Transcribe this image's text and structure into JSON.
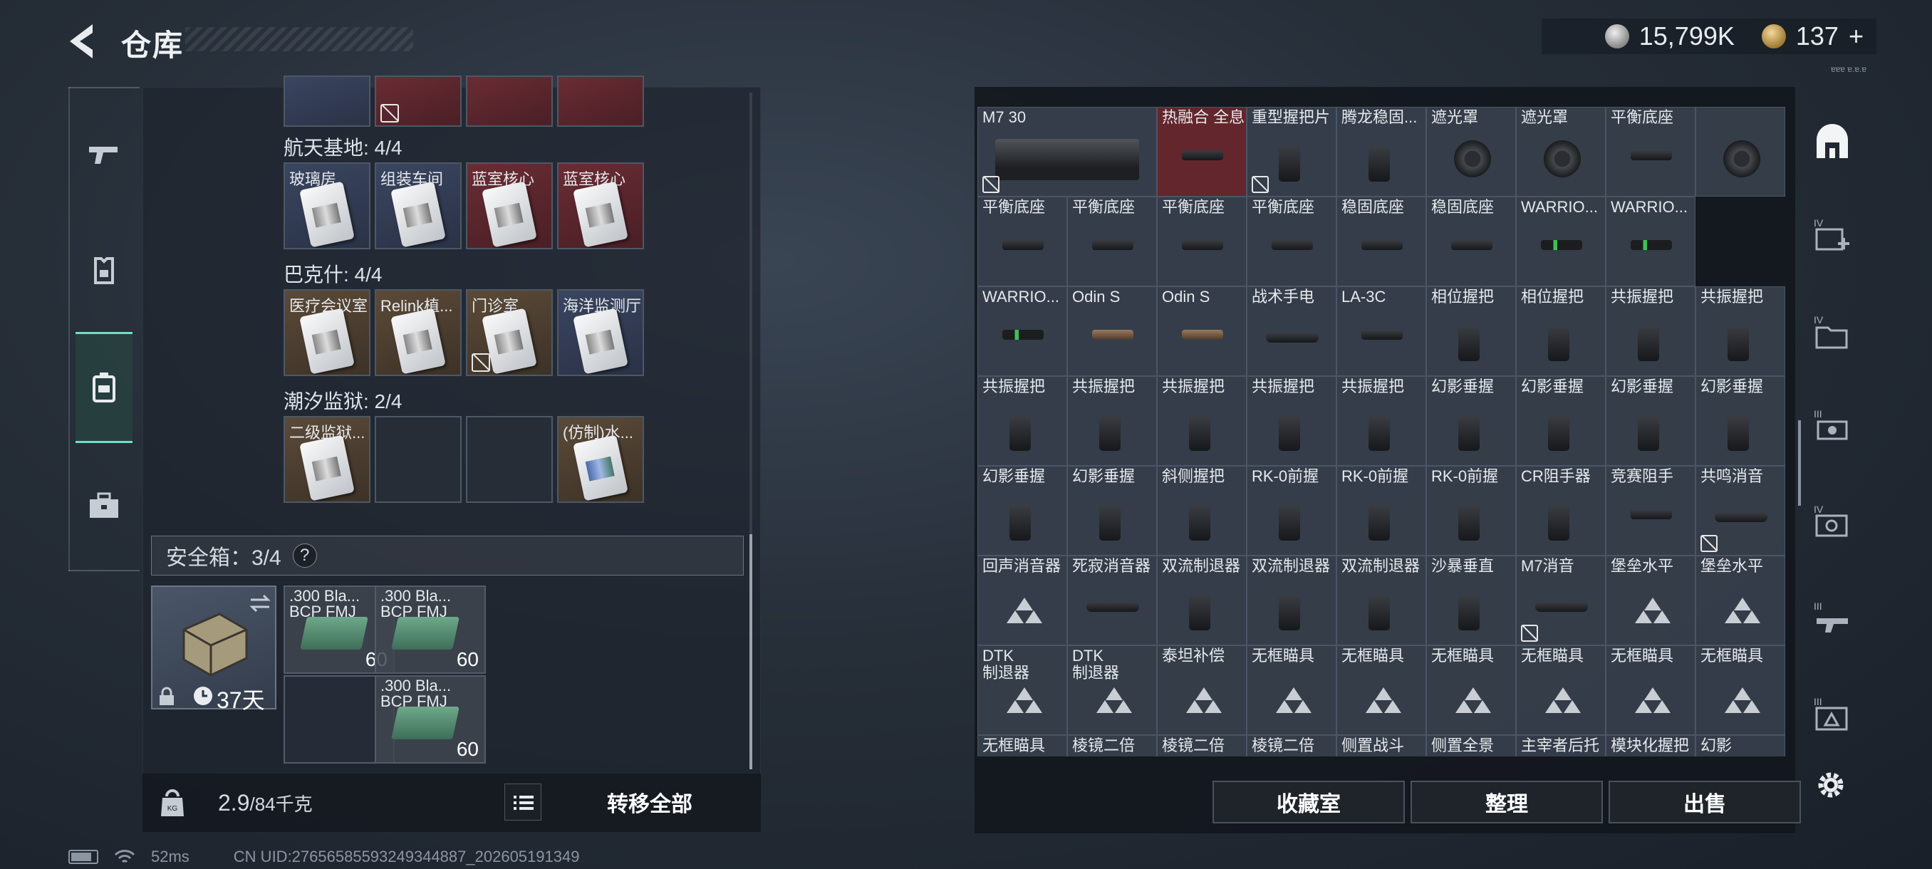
{
  "header": {
    "title": "仓库",
    "silver": "15,799K",
    "gold": "137",
    "gold_plus": "+",
    "version": "ɐɐɐ ɐ.ɐ.ɐ"
  },
  "left_nav": {
    "items": [
      {
        "icon": "gun-icon"
      },
      {
        "icon": "armor-icon"
      },
      {
        "icon": "backpack-icon"
      },
      {
        "icon": "briefcase-icon"
      }
    ]
  },
  "sections": [
    {
      "title": "航天基地: 4/4",
      "cards": [
        {
          "label": "玻璃房",
          "color": "blue"
        },
        {
          "label": "组装车间",
          "color": "blue"
        },
        {
          "label": "蓝室核心",
          "color": "red"
        },
        {
          "label": "蓝室核心",
          "color": "red"
        }
      ]
    },
    {
      "title": "巴克什: 4/4",
      "cards": [
        {
          "label": "医疗会议室",
          "color": "brown"
        },
        {
          "label": "Relink植...",
          "color": "brown"
        },
        {
          "label": "门诊室",
          "color": "brown"
        },
        {
          "label": "海洋监测厅",
          "color": "blue"
        }
      ]
    },
    {
      "title": "潮汐监狱: 2/4",
      "cards": [
        {
          "label": "二级监狱...",
          "color": "brown"
        },
        {
          "label": "",
          "color": "empty"
        },
        {
          "label": "",
          "color": "empty"
        },
        {
          "label": "(仿制)水...",
          "color": "brown"
        }
      ]
    }
  ],
  "safe": {
    "title": "安全箱：3/4",
    "help": "?",
    "days": "37天",
    "ammo": [
      {
        "name": ".300 Bla...",
        "type": "BCP FMJ",
        "qty": "60"
      },
      {
        "name": ".300 Bla...",
        "type": "BCP FMJ",
        "qty": "60"
      },
      {
        "name": ".300 Bla...",
        "type": "BCP FMJ",
        "qty": "60"
      }
    ]
  },
  "bottom": {
    "weight": "2.9",
    "weight_max": "/84千克",
    "transfer": "转移全部"
  },
  "grid": {
    "rows": [
      [
        "M7 30",
        "热融合 全息",
        "重型握把片",
        "腾龙稳固...",
        "遮光罩",
        "遮光罩",
        "平衡底座",
        ""
      ],
      [
        "平衡底座",
        "平衡底座",
        "平衡底座",
        "平衡底座",
        "稳固底座",
        "稳固底座",
        "WARRIO...",
        "WARRIO..."
      ],
      [
        "WARRIO...",
        "Odin S",
        "Odin S",
        "战术手电",
        "LA-3C",
        "相位握把",
        "相位握把",
        "共振握把",
        "共振握把"
      ],
      [
        "共振握把",
        "共振握把",
        "共振握把",
        "共振握把",
        "共振握把",
        "幻影垂握",
        "幻影垂握",
        "幻影垂握",
        "幻影垂握"
      ],
      [
        "幻影垂握",
        "幻影垂握",
        "斜侧握把",
        "RK-0前握",
        "RK-0前握",
        "RK-0前握",
        "CR阻手器",
        "竞赛阻手",
        "共鸣消音"
      ],
      [
        "回声消音器",
        "死寂消音器",
        "双流制退器",
        "双流制退器",
        "双流制退器",
        "沙暴垂直",
        "M7消音",
        "堡垒水平",
        "堡垒水平"
      ],
      [
        "DTK\n制退器",
        "DTK\n制退器",
        "泰坦补偿",
        "无框瞄具",
        "无框瞄具",
        "无框瞄具",
        "无框瞄具",
        "无框瞄具",
        "无框瞄具"
      ],
      [
        "无框瞄具",
        "棱镜二倍",
        "棱镜二倍",
        "棱镜二倍",
        "侧置战斗",
        "侧置全景",
        "主宰者后托",
        "模块化握把",
        "幻影"
      ]
    ]
  },
  "buttons": {
    "collection": "收藏室",
    "sort": "整理",
    "sell": "出售"
  },
  "status": {
    "ping": "52ms",
    "uid": "CN UID:27656585593249344887_202605191349"
  }
}
